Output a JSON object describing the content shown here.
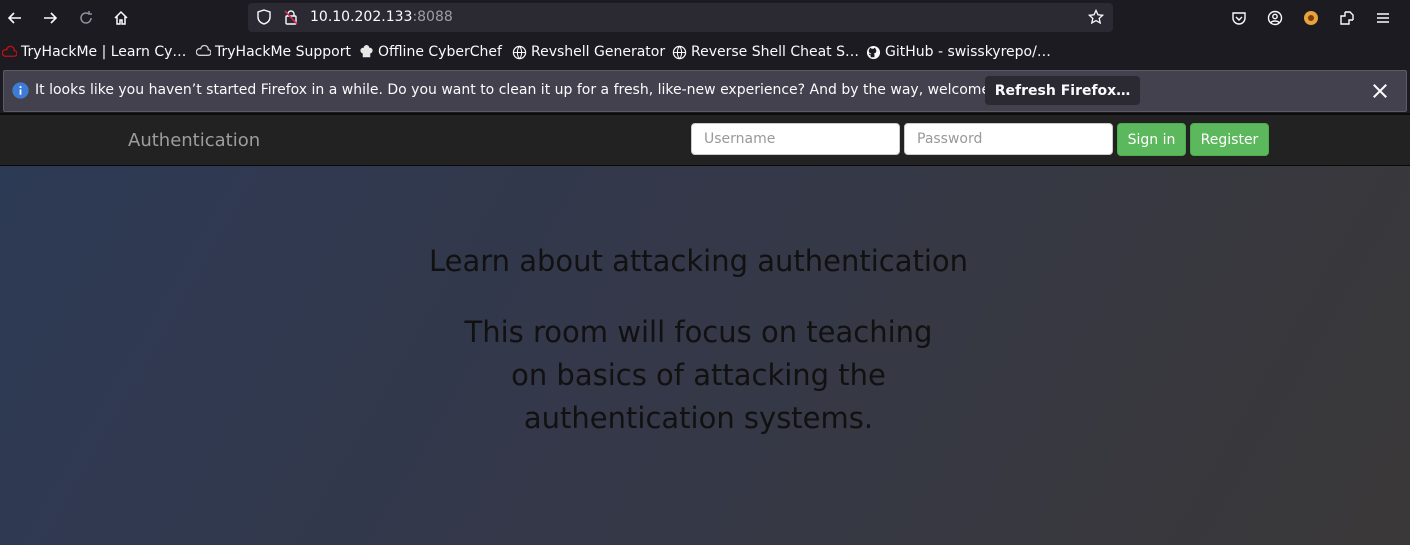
{
  "browser": {
    "url_host": "10.10.202.133",
    "url_port": ":8088",
    "icons": [
      "back-icon",
      "forward-icon",
      "reload-icon",
      "home-icon",
      "shield-icon",
      "lock-icon",
      "star-icon",
      "pocket-icon",
      "account-icon",
      "extension-icon",
      "share-icon",
      "menu-icon"
    ]
  },
  "bookmarks": [
    {
      "label": "TryHackMe | Learn Cy…",
      "icon": "tryhackme-icon"
    },
    {
      "label": "TryHackMe Support",
      "icon": "cloud-icon"
    },
    {
      "label": "Offline CyberChef",
      "icon": "chef-icon"
    },
    {
      "label": "Revshell Generator",
      "icon": "globe-icon"
    },
    {
      "label": "Reverse Shell Cheat S…",
      "icon": "globe-icon"
    },
    {
      "label": "GitHub - swisskyrepo/…",
      "icon": "github-icon"
    }
  ],
  "notification": {
    "text": "It looks like you haven’t started Firefox in a while. Do you want to clean it up for a fresh, like-new experience? And by the way, welcome back!",
    "button": "Refresh Firefox…"
  },
  "site": {
    "brand": "Authentication",
    "username_placeholder": "Username",
    "password_placeholder": "Password",
    "signin_label": "Sign in",
    "register_label": "Register",
    "hero_title": "Learn about attacking authentication",
    "hero_subtitle": "This room will focus on teaching on basics of attacking the authentication systems."
  },
  "colors": {
    "navbar": "#222222",
    "button_green": "#5cb85c",
    "firefox_dark": "#1c1b22"
  }
}
